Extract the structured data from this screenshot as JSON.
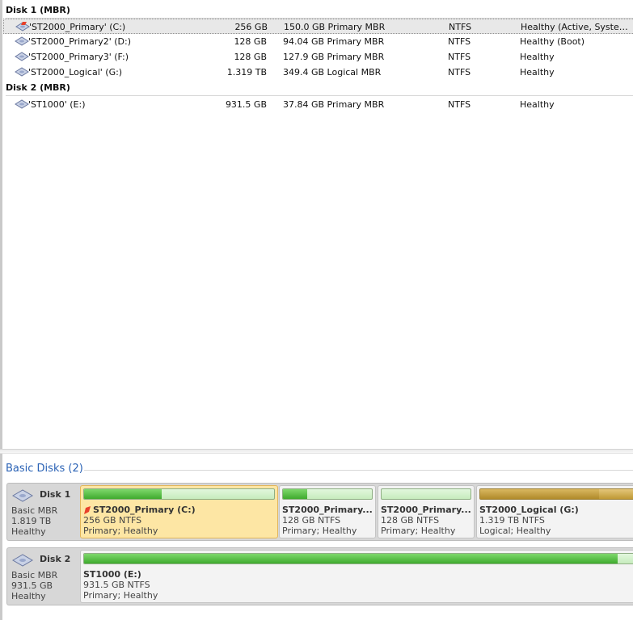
{
  "volume_list": {
    "groups": [
      {
        "header": "Disk 1 (MBR)",
        "rows": [
          {
            "name": "'ST2000_Primary' (C:)",
            "capacity": "256 GB",
            "free_space": "150.0 GB Primary MBR",
            "file_system": "NTFS",
            "status": "Healthy (Active, System, B...",
            "selected": true,
            "system_volume": true
          },
          {
            "name": "'ST2000_Primary2' (D:)",
            "capacity": "128 GB",
            "free_space": "94.04 GB Primary MBR",
            "file_system": "NTFS",
            "status": "Healthy (Boot)"
          },
          {
            "name": "'ST2000_Primary3' (F:)",
            "capacity": "128 GB",
            "free_space": "127.9 GB Primary MBR",
            "file_system": "NTFS",
            "status": "Healthy"
          },
          {
            "name": "'ST2000_Logical' (G:)",
            "capacity": "1.319 TB",
            "free_space": "349.4 GB Logical MBR",
            "file_system": "NTFS",
            "status": "Healthy"
          }
        ]
      },
      {
        "header": "Disk 2 (MBR)",
        "rows": [
          {
            "name": "'ST1000' (E:)",
            "capacity": "931.5 GB",
            "free_space": "37.84 GB Primary MBR",
            "file_system": "NTFS",
            "status": "Healthy"
          }
        ]
      }
    ]
  },
  "graphic_view": {
    "section_title": "Basic Disks (2)",
    "disks": [
      {
        "name": "Disk 1",
        "type": "Basic MBR",
        "size": "1.819 TB",
        "status": "Healthy",
        "partitions": [
          {
            "name": "ST2000_Primary (C:)",
            "size_fs": "256 GB NTFS",
            "status": "Primary; Healthy",
            "used_fraction": 0.41,
            "kind": "primary",
            "selected": true,
            "system_flag": true
          },
          {
            "name": "ST2000_Primary...",
            "size_fs": "128 GB NTFS",
            "status": "Primary; Healthy",
            "used_fraction": 0.27,
            "kind": "primary"
          },
          {
            "name": "ST2000_Primary...",
            "size_fs": "128 GB NTFS",
            "status": "Primary; Healthy",
            "used_fraction": 0.0,
            "kind": "primary"
          },
          {
            "name": "ST2000_Logical (G:)",
            "size_fs": "1.319 TB NTFS",
            "status": "Logical; Healthy",
            "used_fraction": 0.74,
            "kind": "logical"
          }
        ]
      },
      {
        "name": "Disk 2",
        "type": "Basic MBR",
        "size": "931.5 GB",
        "status": "Healthy",
        "partitions": [
          {
            "name": "ST1000 (E:)",
            "size_fs": "931.5 GB NTFS",
            "status": "Primary; Healthy",
            "used_fraction": 0.96,
            "kind": "primary"
          }
        ]
      }
    ]
  },
  "colors": {
    "section_title": "#2a62b5",
    "selection_fill": "#fde6a4",
    "used_green": "#3faa2e",
    "free_green": "#c6ecbd",
    "logical_gold": "#bf9935"
  }
}
